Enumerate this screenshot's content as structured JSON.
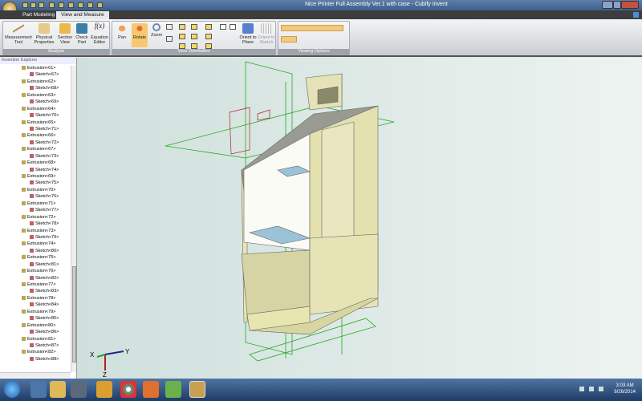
{
  "window": {
    "title": "Nice Printer Full Assembly Ver.1 with case - Cubify Invent"
  },
  "tabs": [
    {
      "label": "Part Modeling",
      "active": false
    },
    {
      "label": "View and Measure",
      "active": true
    }
  ],
  "ribbon": {
    "analysis": {
      "label": "Analysis",
      "buttons": [
        "Measurement Tool",
        "Physical Properties",
        "Section View",
        "Check Part",
        "Equation Editor"
      ]
    },
    "view_orientation": {
      "label": "View Orientation",
      "buttons": [
        "Pan",
        "Rotate",
        "Zoom",
        "Orient to Plane",
        "Orient to Sketch"
      ]
    },
    "viewing_options": {
      "label": "Viewing Options"
    }
  },
  "explorer": {
    "title": "Invention Explorer",
    "items": [
      [
        "Extrusion<61>",
        "Sketch<67>"
      ],
      [
        "Extrusion<62>",
        "Sketch<68>"
      ],
      [
        "Extrusion<63>",
        "Sketch<69>"
      ],
      [
        "Extrusion<64>",
        "Sketch<70>"
      ],
      [
        "Extrusion<65>",
        "Sketch<71>"
      ],
      [
        "Extrusion<66>",
        "Sketch<72>"
      ],
      [
        "Extrusion<67>",
        "Sketch<73>"
      ],
      [
        "Extrusion<68>",
        "Sketch<74>"
      ],
      [
        "Extrusion<69>",
        "Sketch<75>"
      ],
      [
        "Extrusion<70>",
        "Sketch<76>"
      ],
      [
        "Extrusion<71>",
        "Sketch<77>"
      ],
      [
        "Extrusion<72>",
        "Sketch<78>"
      ],
      [
        "Extrusion<73>",
        "Sketch<79>"
      ],
      [
        "Extrusion<74>",
        "Sketch<80>"
      ],
      [
        "Extrusion<75>",
        "Sketch<81>"
      ],
      [
        "Extrusion<76>",
        "Sketch<82>"
      ],
      [
        "Extrusion<77>",
        "Sketch<83>"
      ],
      [
        "Extrusion<78>",
        "Sketch<84>"
      ],
      [
        "Extrusion<79>",
        "Sketch<85>"
      ],
      [
        "Extrusion<80>",
        "Sketch<86>"
      ],
      [
        "Extrusion<81>",
        "Sketch<87>"
      ],
      [
        "Extrusion<82>",
        "Sketch<88>"
      ]
    ]
  },
  "triad": {
    "x": "X",
    "y": "Y",
    "z": "Z"
  },
  "taskbar": {
    "time": "3:03 AM",
    "date": "9/26/2014"
  },
  "colors": {
    "accent": "#f5c060",
    "model": "#e8e6b0",
    "planes": "#22aa22",
    "sketch": "#aa2222"
  }
}
